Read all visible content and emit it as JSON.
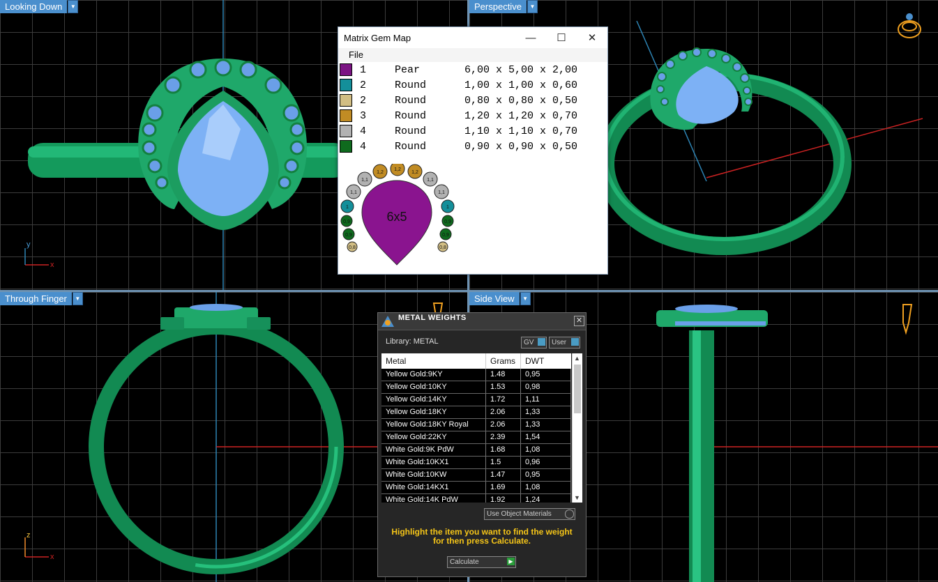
{
  "viewports": {
    "top_left": {
      "label": "Looking Down",
      "axis_v": "y",
      "axis_h": "x"
    },
    "top_right": {
      "label": "Perspective"
    },
    "bottom_left": {
      "label": "Through Finger",
      "axis_v": "z",
      "axis_h": "x"
    },
    "bottom_right": {
      "label": "Side View"
    }
  },
  "gem_map": {
    "title": "Matrix Gem Map",
    "menu_file": "File",
    "rows": [
      {
        "color": "#7b1483",
        "count": "1",
        "shape": "Pear",
        "size": "6,00 x 5,00 x 2,00"
      },
      {
        "color": "#148f9a",
        "count": "2",
        "shape": "Round",
        "size": "1,00 x 1,00 x 0,60"
      },
      {
        "color": "#d2be84",
        "count": "2",
        "shape": "Round",
        "size": "0,80 x 0,80 x 0,50"
      },
      {
        "color": "#c18c24",
        "count": "3",
        "shape": "Round",
        "size": "1,20 x 1,20 x 0,70"
      },
      {
        "color": "#b2b2b2",
        "count": "4",
        "shape": "Round",
        "size": "1,10 x 1,10 x 0,70"
      },
      {
        "color": "#0f6b1e",
        "count": "4",
        "shape": "Round",
        "size": "0,90 x 0,90 x 0,50"
      }
    ],
    "diagram": {
      "center_label": "6x5",
      "labels": {
        "gold": "1,2",
        "gray": "1,1",
        "teal": "1",
        "green": "0,9",
        "tan": "0,8"
      }
    }
  },
  "metal_weights": {
    "title": "METAL WEIGHTS",
    "library": "Library: METAL",
    "gv_label": "GV",
    "user_label": "User",
    "columns": [
      "Metal",
      "Grams",
      "DWT"
    ],
    "rows": [
      [
        "Yellow Gold:9KY",
        "1.48",
        "0,95"
      ],
      [
        "Yellow Gold:10KY",
        "1.53",
        "0,98"
      ],
      [
        "Yellow Gold:14KY",
        "1.72",
        "1,11"
      ],
      [
        "Yellow Gold:18KY",
        "2.06",
        "1,33"
      ],
      [
        "Yellow Gold:18KY Royal",
        "2.06",
        "1,33"
      ],
      [
        "Yellow Gold:22KY",
        "2.39",
        "1,54"
      ],
      [
        "White Gold:9K PdW",
        "1.68",
        "1,08"
      ],
      [
        "White Gold:10KX1",
        "1.5",
        "0,96"
      ],
      [
        "White Gold:10KW",
        "1.47",
        "0,95"
      ],
      [
        "White Gold:14KX1",
        "1.69",
        "1,08"
      ],
      [
        "White Gold:14K PdW",
        "1.92",
        "1,24"
      ]
    ],
    "use_object_materials": "Use Object Materials",
    "instruction": "Highlight the item you want to find the weight for then press Calculate.",
    "calculate": "Calculate"
  }
}
